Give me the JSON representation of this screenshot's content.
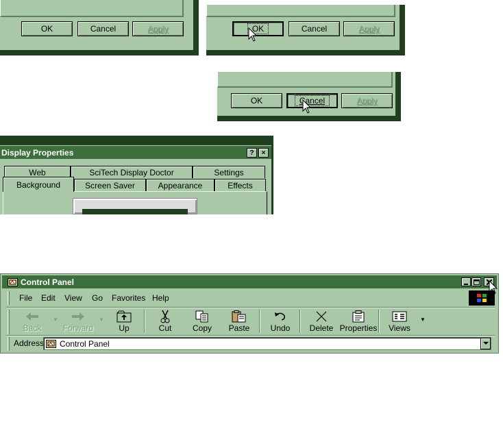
{
  "dialogs": {
    "d1": {
      "ok": "OK",
      "cancel": "Cancel",
      "apply": "Apply"
    },
    "d2": {
      "ok": "OK",
      "cancel": "Cancel",
      "apply": "Apply"
    },
    "d3": {
      "ok": "OK",
      "cancel": "Cancel",
      "apply": "Apply"
    }
  },
  "display_properties": {
    "title": "Display Properties",
    "help": "?",
    "close": "×",
    "tabs_row1": [
      "Web",
      "SciTech Display Doctor",
      "Settings"
    ],
    "tabs_row2": [
      "Background",
      "Screen Saver",
      "Appearance",
      "Effects"
    ]
  },
  "control_panel": {
    "title": "Control Panel",
    "menu": [
      "File",
      "Edit",
      "View",
      "Go",
      "Favorites",
      "Help"
    ],
    "toolbar": [
      "Back",
      "Forward",
      "Up",
      "Cut",
      "Copy",
      "Paste",
      "Undo",
      "Delete",
      "Properties",
      "Views"
    ],
    "address_label": "Address",
    "address_value": "Control Panel"
  }
}
